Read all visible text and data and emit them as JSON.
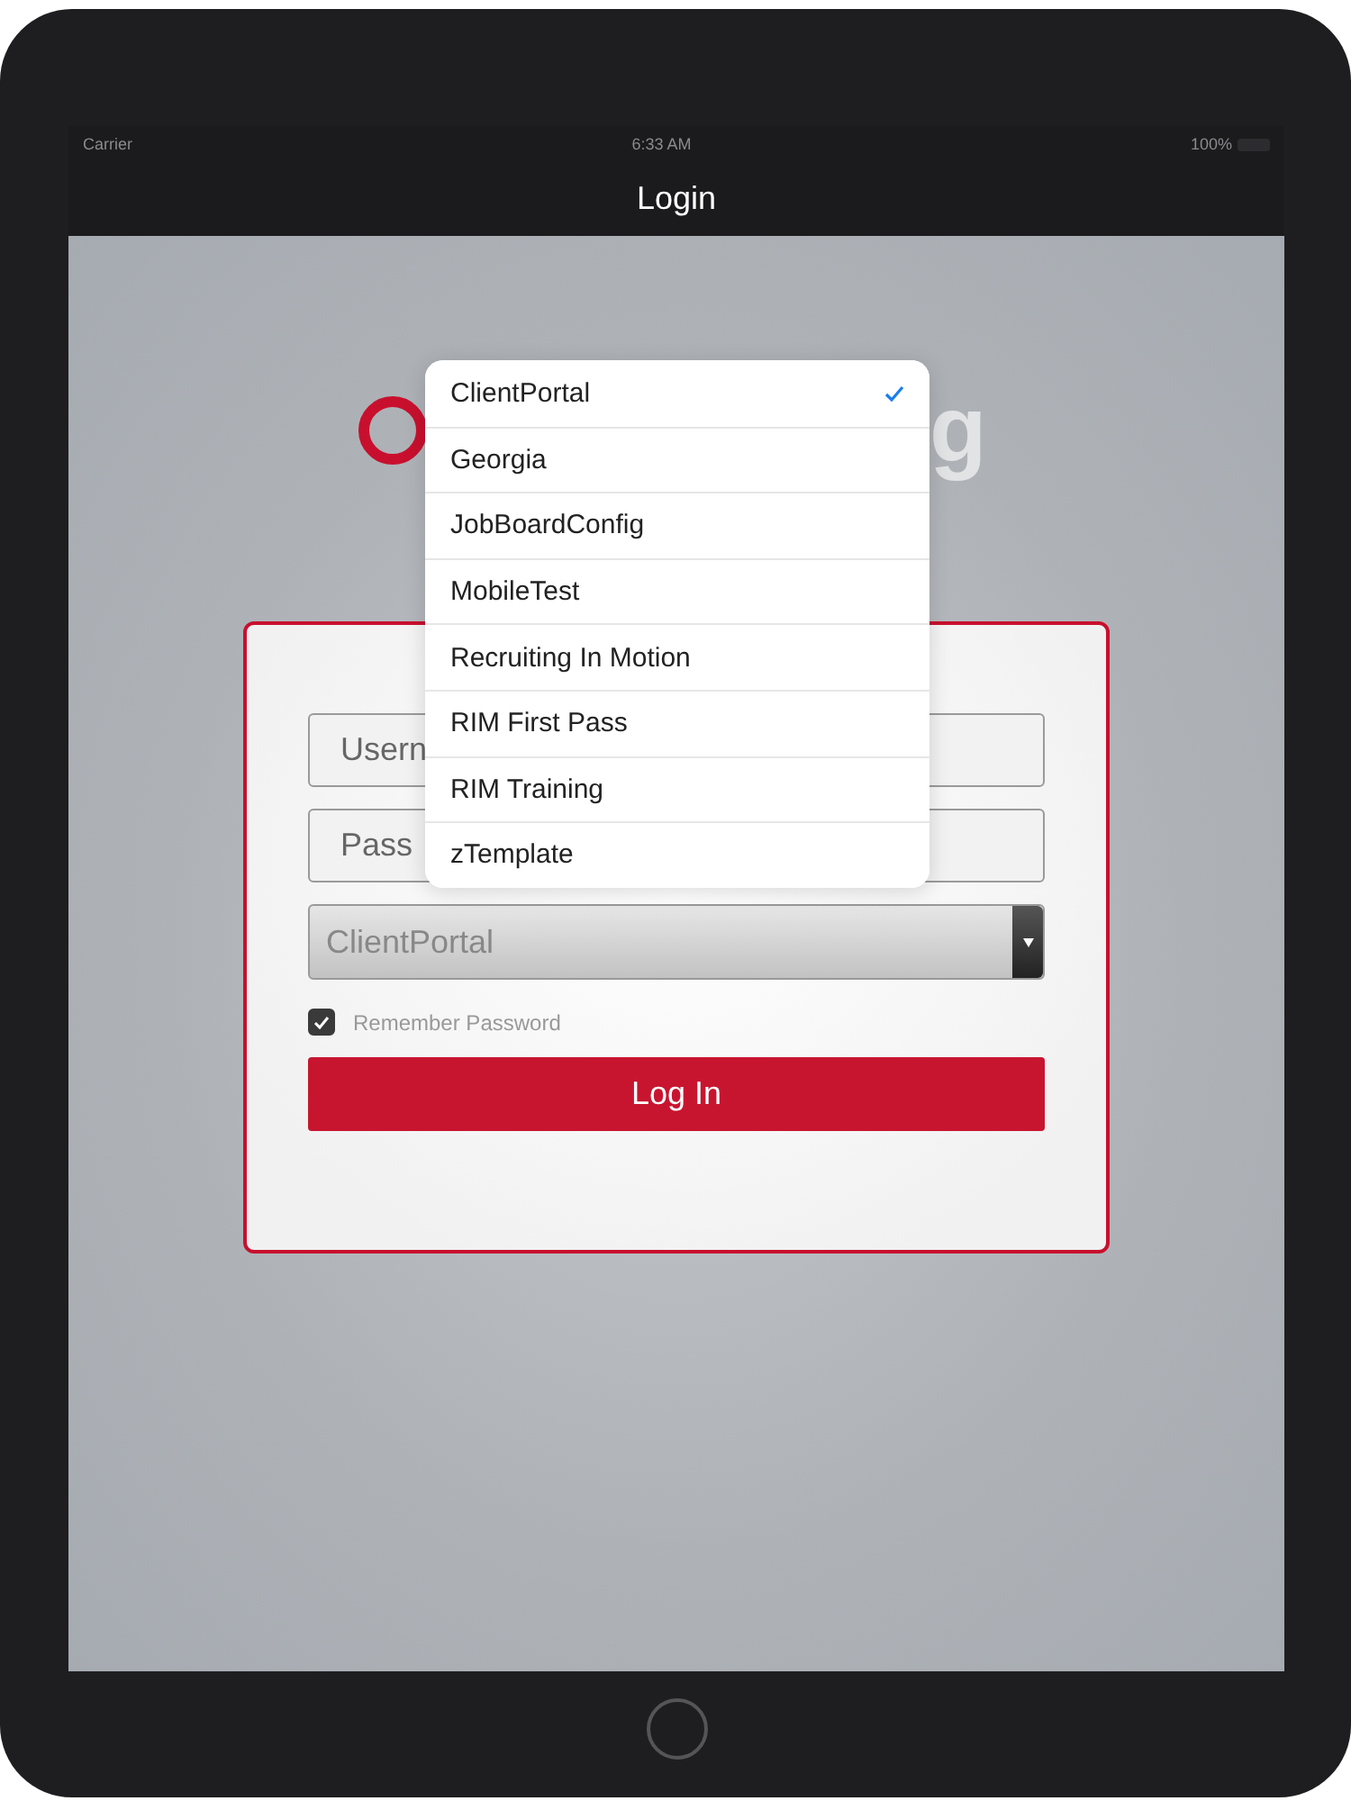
{
  "status_bar": {
    "carrier": "Carrier",
    "time": "6:33 AM",
    "battery": "100%"
  },
  "nav_bar": {
    "title": "Login"
  },
  "logo": {
    "visible_text": "g"
  },
  "form": {
    "username": {
      "placeholder": "Usern"
    },
    "password": {
      "placeholder": "Pass"
    },
    "site_select": {
      "value": "ClientPortal"
    },
    "remember_password": {
      "label": "Remember Password",
      "checked": true
    },
    "login_button": "Log In"
  },
  "dropdown": {
    "options": [
      {
        "label": "ClientPortal",
        "selected": true
      },
      {
        "label": "Georgia",
        "selected": false
      },
      {
        "label": "JobBoardConfig",
        "selected": false
      },
      {
        "label": "MobileTest",
        "selected": false
      },
      {
        "label": "Recruiting In Motion",
        "selected": false
      },
      {
        "label": "RIM First Pass",
        "selected": false
      },
      {
        "label": "RIM Training",
        "selected": false
      },
      {
        "label": "zTemplate",
        "selected": false
      }
    ]
  }
}
